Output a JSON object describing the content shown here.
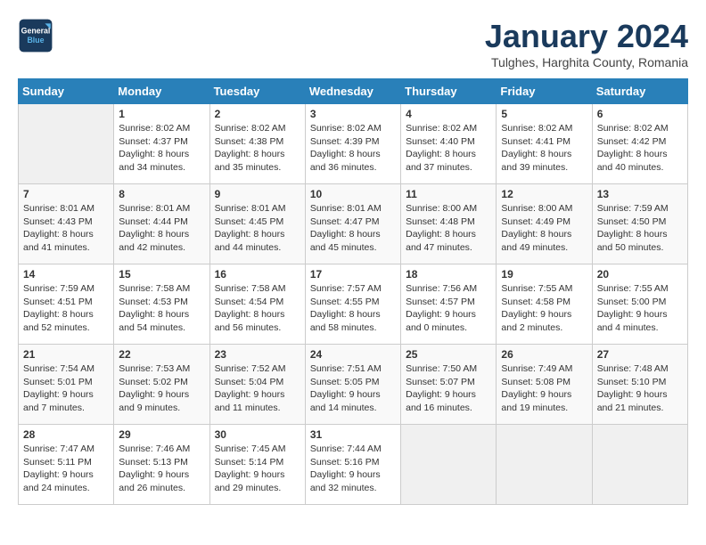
{
  "header": {
    "logo_line1": "General",
    "logo_line2": "Blue",
    "month_title": "January 2024",
    "location": "Tulghes, Harghita County, Romania"
  },
  "weekdays": [
    "Sunday",
    "Monday",
    "Tuesday",
    "Wednesday",
    "Thursday",
    "Friday",
    "Saturday"
  ],
  "weeks": [
    [
      {
        "day": "",
        "empty": true
      },
      {
        "day": "1",
        "sunrise": "8:02 AM",
        "sunset": "4:37 PM",
        "daylight": "8 hours and 34 minutes."
      },
      {
        "day": "2",
        "sunrise": "8:02 AM",
        "sunset": "4:38 PM",
        "daylight": "8 hours and 35 minutes."
      },
      {
        "day": "3",
        "sunrise": "8:02 AM",
        "sunset": "4:39 PM",
        "daylight": "8 hours and 36 minutes."
      },
      {
        "day": "4",
        "sunrise": "8:02 AM",
        "sunset": "4:40 PM",
        "daylight": "8 hours and 37 minutes."
      },
      {
        "day": "5",
        "sunrise": "8:02 AM",
        "sunset": "4:41 PM",
        "daylight": "8 hours and 39 minutes."
      },
      {
        "day": "6",
        "sunrise": "8:02 AM",
        "sunset": "4:42 PM",
        "daylight": "8 hours and 40 minutes."
      }
    ],
    [
      {
        "day": "7",
        "sunrise": "8:01 AM",
        "sunset": "4:43 PM",
        "daylight": "8 hours and 41 minutes."
      },
      {
        "day": "8",
        "sunrise": "8:01 AM",
        "sunset": "4:44 PM",
        "daylight": "8 hours and 42 minutes."
      },
      {
        "day": "9",
        "sunrise": "8:01 AM",
        "sunset": "4:45 PM",
        "daylight": "8 hours and 44 minutes."
      },
      {
        "day": "10",
        "sunrise": "8:01 AM",
        "sunset": "4:47 PM",
        "daylight": "8 hours and 45 minutes."
      },
      {
        "day": "11",
        "sunrise": "8:00 AM",
        "sunset": "4:48 PM",
        "daylight": "8 hours and 47 minutes."
      },
      {
        "day": "12",
        "sunrise": "8:00 AM",
        "sunset": "4:49 PM",
        "daylight": "8 hours and 49 minutes."
      },
      {
        "day": "13",
        "sunrise": "7:59 AM",
        "sunset": "4:50 PM",
        "daylight": "8 hours and 50 minutes."
      }
    ],
    [
      {
        "day": "14",
        "sunrise": "7:59 AM",
        "sunset": "4:51 PM",
        "daylight": "8 hours and 52 minutes."
      },
      {
        "day": "15",
        "sunrise": "7:58 AM",
        "sunset": "4:53 PM",
        "daylight": "8 hours and 54 minutes."
      },
      {
        "day": "16",
        "sunrise": "7:58 AM",
        "sunset": "4:54 PM",
        "daylight": "8 hours and 56 minutes."
      },
      {
        "day": "17",
        "sunrise": "7:57 AM",
        "sunset": "4:55 PM",
        "daylight": "8 hours and 58 minutes."
      },
      {
        "day": "18",
        "sunrise": "7:56 AM",
        "sunset": "4:57 PM",
        "daylight": "9 hours and 0 minutes."
      },
      {
        "day": "19",
        "sunrise": "7:55 AM",
        "sunset": "4:58 PM",
        "daylight": "9 hours and 2 minutes."
      },
      {
        "day": "20",
        "sunrise": "7:55 AM",
        "sunset": "5:00 PM",
        "daylight": "9 hours and 4 minutes."
      }
    ],
    [
      {
        "day": "21",
        "sunrise": "7:54 AM",
        "sunset": "5:01 PM",
        "daylight": "9 hours and 7 minutes."
      },
      {
        "day": "22",
        "sunrise": "7:53 AM",
        "sunset": "5:02 PM",
        "daylight": "9 hours and 9 minutes."
      },
      {
        "day": "23",
        "sunrise": "7:52 AM",
        "sunset": "5:04 PM",
        "daylight": "9 hours and 11 minutes."
      },
      {
        "day": "24",
        "sunrise": "7:51 AM",
        "sunset": "5:05 PM",
        "daylight": "9 hours and 14 minutes."
      },
      {
        "day": "25",
        "sunrise": "7:50 AM",
        "sunset": "5:07 PM",
        "daylight": "9 hours and 16 minutes."
      },
      {
        "day": "26",
        "sunrise": "7:49 AM",
        "sunset": "5:08 PM",
        "daylight": "9 hours and 19 minutes."
      },
      {
        "day": "27",
        "sunrise": "7:48 AM",
        "sunset": "5:10 PM",
        "daylight": "9 hours and 21 minutes."
      }
    ],
    [
      {
        "day": "28",
        "sunrise": "7:47 AM",
        "sunset": "5:11 PM",
        "daylight": "9 hours and 24 minutes."
      },
      {
        "day": "29",
        "sunrise": "7:46 AM",
        "sunset": "5:13 PM",
        "daylight": "9 hours and 26 minutes."
      },
      {
        "day": "30",
        "sunrise": "7:45 AM",
        "sunset": "5:14 PM",
        "daylight": "9 hours and 29 minutes."
      },
      {
        "day": "31",
        "sunrise": "7:44 AM",
        "sunset": "5:16 PM",
        "daylight": "9 hours and 32 minutes."
      },
      {
        "day": "",
        "empty": true
      },
      {
        "day": "",
        "empty": true
      },
      {
        "day": "",
        "empty": true
      }
    ]
  ]
}
